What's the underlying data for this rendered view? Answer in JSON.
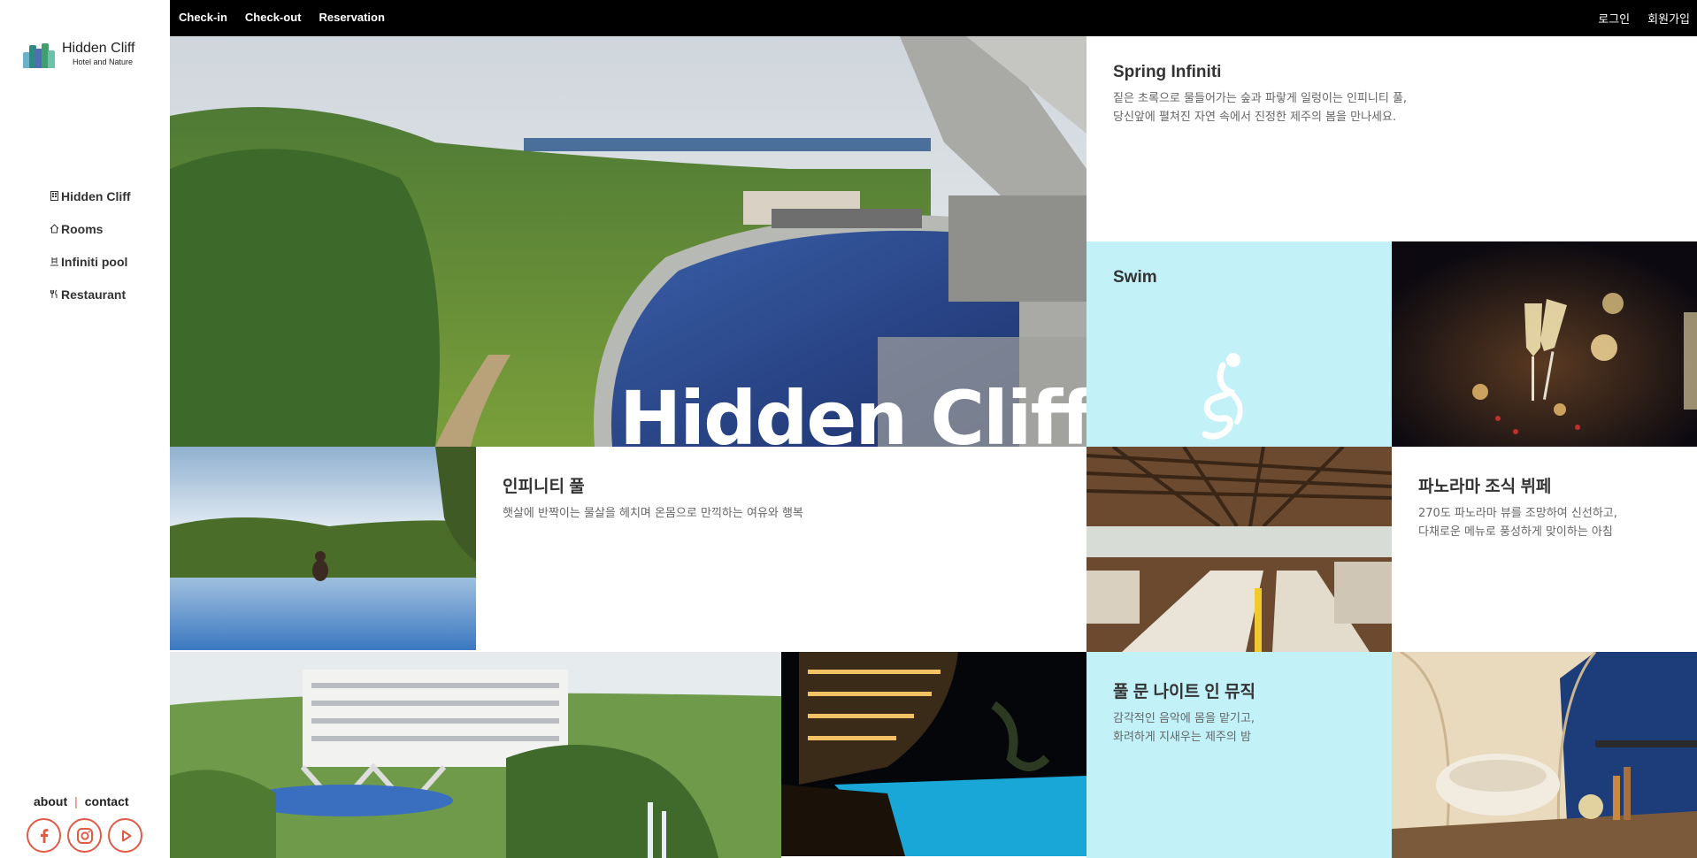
{
  "brand": {
    "name": "Hidden Cliff",
    "tagline": "Hotel and Nature"
  },
  "topbar": {
    "left": [
      "Check-in",
      "Check-out",
      "Reservation"
    ],
    "right": [
      "로그인",
      "회원가입"
    ]
  },
  "sidebar": {
    "items": [
      {
        "label": "Hidden Cliff",
        "icon": "building-icon"
      },
      {
        "label": "Rooms",
        "icon": "home-icon"
      },
      {
        "label": "Infiniti pool",
        "icon": "pool-icon"
      },
      {
        "label": "Restaurant",
        "icon": "utensils-icon"
      }
    ],
    "footer_links": [
      "about",
      "contact"
    ],
    "footer_sep": "|",
    "socials": [
      "facebook-icon",
      "instagram-icon",
      "youtube-icon"
    ]
  },
  "hero": {
    "title": "Hidden Cliff"
  },
  "spring": {
    "title": "Spring Infiniti",
    "line1": "짙은 초록으로 물들어가는 숲과 파랗게 일렁이는 인피니티 풀,",
    "line2": "당신앞에 펼쳐진 자연 속에서 진정한 제주의 봄을 만나세요."
  },
  "swim": {
    "title": "Swim"
  },
  "infinity_pool": {
    "title": "인피니티 풀",
    "line1": "햇살에 반짝이는 물살을 헤치며 온몸으로 만끽하는 여유와 행복"
  },
  "buffet": {
    "title": "파노라마 조식 뷔페",
    "line1": "270도 파노라마 뷰를 조망하여 신선하고,",
    "line2": "다채로운 메뉴로 풍성하게 맞이하는 아침"
  },
  "music": {
    "title": "풀 문 나이트 인 뮤직",
    "line1": "감각적인 음악에 몸을 맡기고,",
    "line2": "화려하게 지새우는 제주의 밤"
  },
  "colors": {
    "accent": "#e25b45",
    "cyan": "#c2f1f7",
    "topbar": "#000000"
  }
}
